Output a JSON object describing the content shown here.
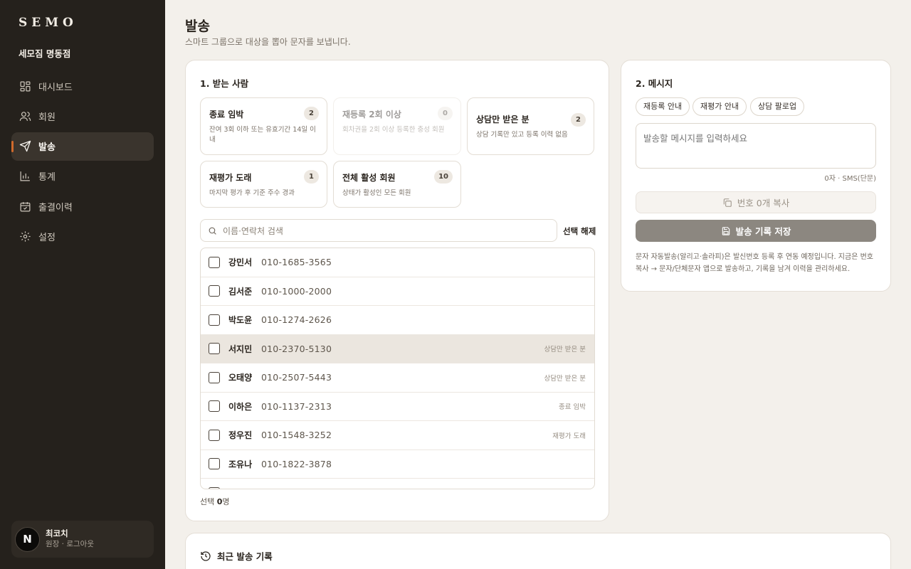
{
  "brand": "SEMO",
  "gym_name": "세모짐 명동점",
  "nav": [
    {
      "label": "대시보드",
      "icon": "dashboard-icon"
    },
    {
      "label": "회원",
      "icon": "users-icon"
    },
    {
      "label": "발송",
      "icon": "send-icon",
      "active": true
    },
    {
      "label": "통계",
      "icon": "bar-chart-icon"
    },
    {
      "label": "출결이력",
      "icon": "calendar-check-icon"
    },
    {
      "label": "설정",
      "icon": "gear-icon"
    }
  ],
  "user": {
    "avatar": "N",
    "name": "최코치",
    "sub": "원장 · 로그아웃"
  },
  "page": {
    "title": "발송",
    "subtitle": "스마트 그룹으로 대상을 뽑아 문자를 보냅니다."
  },
  "recipients": {
    "title": "1. 받는 사람",
    "groups": [
      {
        "title": "종료 임박",
        "desc": "잔여 3회 이하 또는 유효기간 14일 이내",
        "count": "2",
        "disabled": false
      },
      {
        "title": "재등록 2회 이상",
        "desc": "회차권을 2회 이상 등록한 충성 회원",
        "count": "0",
        "disabled": true
      },
      {
        "title": "상담만 받은 분",
        "desc": "상담 기록만 있고 등록 이력 없음",
        "count": "2",
        "disabled": false
      },
      {
        "title": "재평가 도래",
        "desc": "마지막 평가 후 기준 주수 경과",
        "count": "1",
        "disabled": false
      },
      {
        "title": "전체 활성 회원",
        "desc": "상태가 활성인 모든 회원",
        "count": "10",
        "disabled": false
      }
    ],
    "search_placeholder": "이름·연락처 검색",
    "clear_label": "선택 해제",
    "members": [
      {
        "name": "강민서",
        "phone": "010-1685-3565",
        "tag": ""
      },
      {
        "name": "김서준",
        "phone": "010-1000-2000",
        "tag": ""
      },
      {
        "name": "박도윤",
        "phone": "010-1274-2626",
        "tag": ""
      },
      {
        "name": "서지민",
        "phone": "010-2370-5130",
        "tag": "상담만 받은 분"
      },
      {
        "name": "오태양",
        "phone": "010-2507-5443",
        "tag": "상담만 받은 분"
      },
      {
        "name": "이하은",
        "phone": "010-1137-2313",
        "tag": "종료 임박"
      },
      {
        "name": "정우진",
        "phone": "010-1548-3252",
        "tag": "재평가 도래"
      },
      {
        "name": "조유나",
        "phone": "010-1822-3878",
        "tag": ""
      },
      {
        "name": "",
        "phone": "",
        "tag": ""
      }
    ],
    "selected_prefix": "선택 ",
    "selected_count": "0",
    "selected_suffix": "명"
  },
  "message": {
    "title": "2. 메시지",
    "templates": [
      "재등록 안내",
      "재평가 안내",
      "상담 팔로업"
    ],
    "placeholder": "발송할 메시지를 입력하세요",
    "char_count": "0자 · SMS(단문)",
    "copy_label": "번호 0개 복사",
    "save_label": "발송 기록 저장",
    "note": "문자 자동발송(알리고·솔라피)은 발신번호 등록 후 연동 예정입니다. 지금은 번호 복사 → 문자/단체문자 앱으로 발송하고, 기록을 남겨 이력을 관리하세요."
  },
  "recent": {
    "title": "최근 발송 기록"
  },
  "colors": {
    "sidebar": "#25211c",
    "accent": "#d06a2c",
    "background": "#f3f0eb",
    "save_button": "#8c8780"
  }
}
